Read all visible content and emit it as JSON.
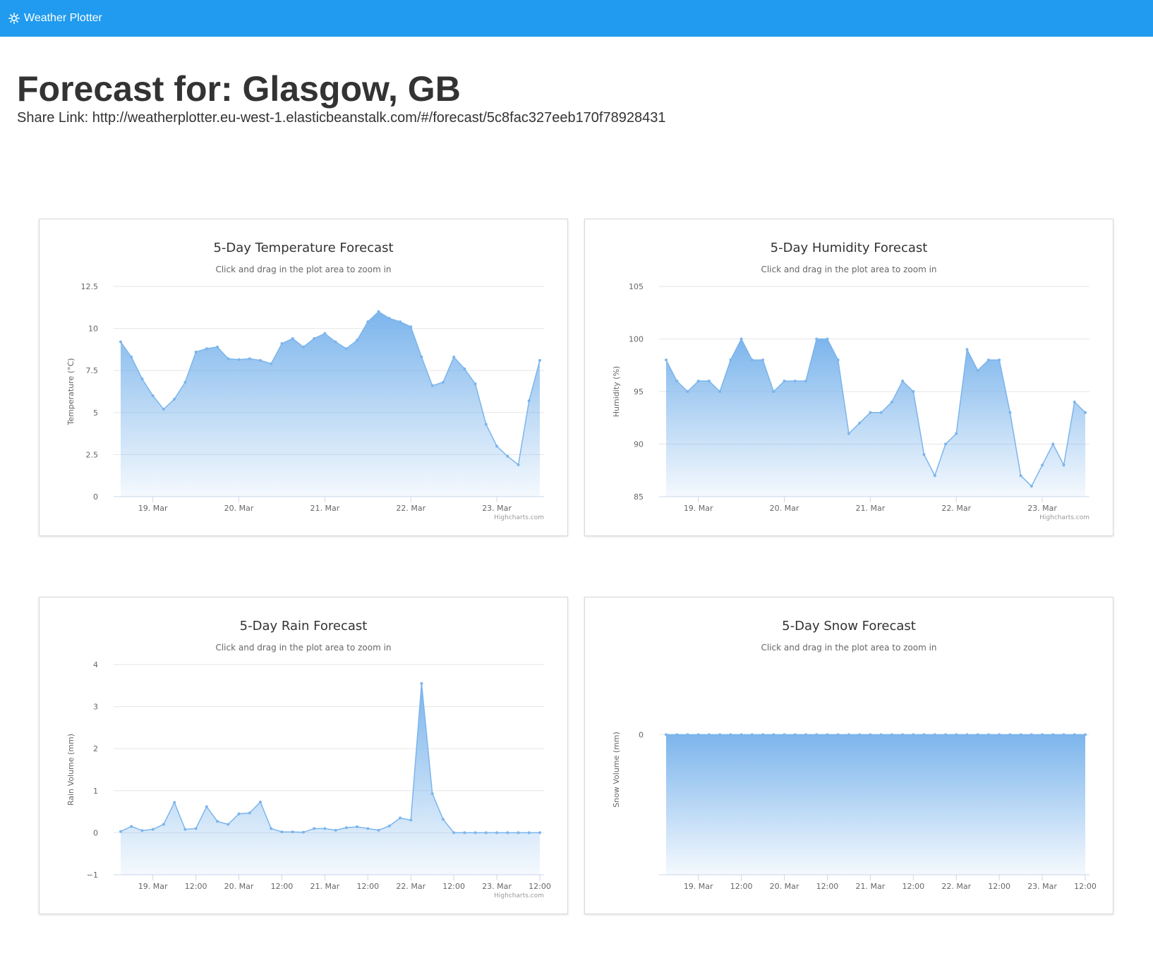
{
  "navbar": {
    "brand": "Weather Plotter",
    "icon": "sun-icon",
    "color": "#209bef"
  },
  "header": {
    "title": "Forecast for: Glasgow, GB",
    "share_link": "Share Link: http://weatherplotter.eu-west-1.elasticbeanstalk.com/#/forecast/5c8fac327eeb170f78928431"
  },
  "chart_data": [
    {
      "id": "temperature",
      "type": "area",
      "title": "5-Day Temperature Forecast",
      "subtitle": "Click and drag in the plot area to zoom in",
      "ylabel": "Temperature (°C)",
      "xlabel": "",
      "credit": "Highcharts.com",
      "ylim": [
        0,
        12.5
      ],
      "yticks": [
        "0",
        "2.5",
        "5",
        "7.5",
        "10",
        "12.5"
      ],
      "xticks": [
        "19. Mar",
        "20. Mar",
        "21. Mar",
        "22. Mar",
        "23. Mar"
      ],
      "x_first_tick_index": 3,
      "values": [
        9.2,
        8.3,
        7.0,
        6.0,
        5.2,
        5.8,
        6.8,
        8.6,
        8.8,
        8.9,
        8.2,
        8.15,
        8.2,
        8.1,
        7.9,
        9.1,
        9.4,
        8.9,
        9.4,
        9.7,
        9.2,
        8.8,
        9.3,
        10.4,
        11.0,
        10.6,
        10.4,
        10.1,
        8.3,
        6.6,
        6.8,
        8.3,
        7.6,
        6.7,
        4.3,
        3.0,
        2.4,
        1.9,
        5.7,
        8.1
      ],
      "color": "#7cb5ec"
    },
    {
      "id": "humidity",
      "type": "area",
      "title": "5-Day Humidity Forecast",
      "subtitle": "Click and drag in the plot area to zoom in",
      "ylabel": "Humidity (%)",
      "xlabel": "",
      "credit": "Highcharts.com",
      "ylim": [
        85,
        105
      ],
      "yticks": [
        "85",
        "90",
        "95",
        "100",
        "105"
      ],
      "xticks": [
        "19. Mar",
        "20. Mar",
        "21. Mar",
        "22. Mar",
        "23. Mar"
      ],
      "x_first_tick_index": 3,
      "values": [
        98,
        96,
        95,
        96,
        96,
        95,
        98,
        100,
        98,
        98,
        95,
        96,
        96,
        96,
        100,
        100,
        98,
        91,
        92,
        93,
        93,
        94,
        96,
        95,
        89,
        87,
        90,
        91,
        99,
        97,
        98,
        98,
        93,
        87,
        86,
        88,
        90,
        88,
        94,
        93
      ],
      "color": "#7cb5ec"
    },
    {
      "id": "rain",
      "type": "area",
      "title": "5-Day Rain Forecast",
      "subtitle": "Click and drag in the plot area to zoom in",
      "ylabel": "Rain Volume (mm)",
      "xlabel": "",
      "credit": "Highcharts.com",
      "ylim": [
        -1,
        4
      ],
      "yticks": [
        "−1",
        "0",
        "1",
        "2",
        "3",
        "4"
      ],
      "xticks": [
        "19. Mar",
        "12:00",
        "20. Mar",
        "12:00",
        "21. Mar",
        "12:00",
        "22. Mar",
        "12:00",
        "23. Mar",
        "12:00"
      ],
      "x_first_tick_index": 3,
      "values": [
        0.03,
        0.15,
        0.05,
        0.08,
        0.2,
        0.72,
        0.08,
        0.1,
        0.62,
        0.27,
        0.2,
        0.45,
        0.47,
        0.73,
        0.1,
        0.02,
        0.02,
        0.01,
        0.1,
        0.1,
        0.06,
        0.12,
        0.14,
        0.1,
        0.06,
        0.16,
        0.35,
        0.3,
        3.55,
        0.93,
        0.32,
        0.0,
        0.0,
        0.0,
        0.0,
        0.0,
        0.0,
        0.0,
        0.0,
        0.0
      ],
      "color": "#7cb5ec"
    },
    {
      "id": "snow",
      "type": "area",
      "title": "5-Day Snow Forecast",
      "subtitle": "Click and drag in the plot area to zoom in",
      "ylabel": "Snow Volume (mm)",
      "xlabel": "",
      "credit": "",
      "ylim": [
        -1,
        0.5
      ],
      "yticks": [
        "0"
      ],
      "xticks": [
        "19. Mar",
        "12:00",
        "20. Mar",
        "12:00",
        "21. Mar",
        "12:00",
        "22. Mar",
        "12:00",
        "23. Mar",
        "12:00"
      ],
      "x_first_tick_index": 3,
      "values": [
        0,
        0,
        0,
        0,
        0,
        0,
        0,
        0,
        0,
        0,
        0,
        0,
        0,
        0,
        0,
        0,
        0,
        0,
        0,
        0,
        0,
        0,
        0,
        0,
        0,
        0,
        0,
        0,
        0,
        0,
        0,
        0,
        0,
        0,
        0,
        0,
        0,
        0,
        0,
        0
      ],
      "color": "#7cb5ec"
    }
  ]
}
